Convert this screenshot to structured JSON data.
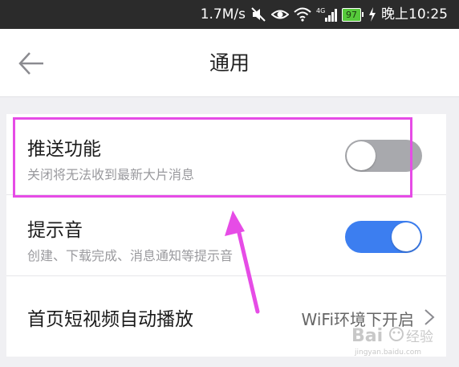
{
  "status_bar": {
    "speed": "1.7M/s",
    "network_label": "4G",
    "battery_level": "97",
    "time": "晚上10:25"
  },
  "header": {
    "title": "通用"
  },
  "settings": [
    {
      "title": "推送功能",
      "description": "关闭将无法收到最新大片消息",
      "toggle_on": false
    },
    {
      "title": "提示音",
      "description": "创建、下载完成、消息通知等提示音",
      "toggle_on": true
    },
    {
      "title": "首页短视频自动播放",
      "value": "WiFi环境下开启"
    }
  ],
  "colors": {
    "toggle_on": "#3c7ef0",
    "toggle_off": "#a8a9ad",
    "annotation": "#e64ce6"
  },
  "watermark": {
    "brand": "Bai",
    "brand_suffix": "经验",
    "url": "jingyan.baidu.com"
  }
}
